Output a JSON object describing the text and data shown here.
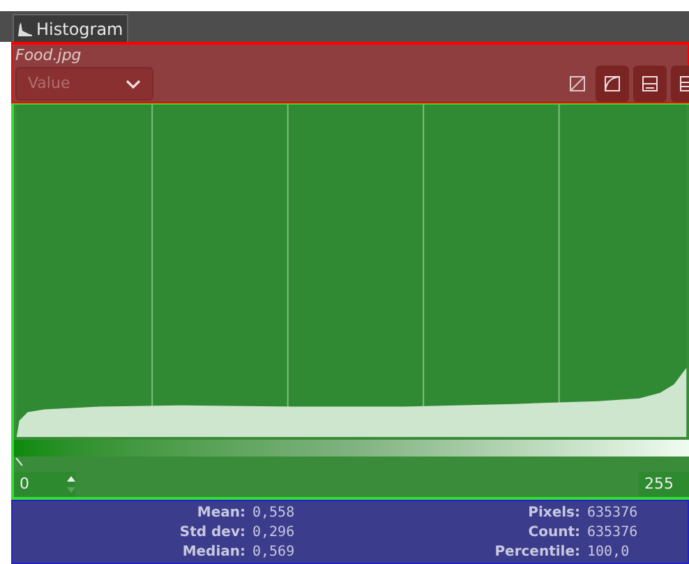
{
  "tab": {
    "label": "Histogram",
    "selected": true
  },
  "image_name": "Food.jpg",
  "channel_select": {
    "value": "Value",
    "disabled": true
  },
  "toolbar": [
    {
      "kind": "linear",
      "selected": false
    },
    {
      "kind": "log",
      "selected": true
    },
    {
      "kind": "display",
      "selected": true
    },
    {
      "kind": "display2",
      "selected": true
    }
  ],
  "range": {
    "low": "0",
    "high": "255"
  },
  "stats": [
    [
      {
        "label": "Mean:",
        "value": "0,558"
      },
      {
        "label": "Std dev:",
        "value": "0,296"
      },
      {
        "label": "Median:",
        "value": "0,569"
      }
    ],
    [
      {
        "label": "Pixels:",
        "value": "635376"
      },
      {
        "label": "Count:",
        "value": "635376"
      },
      {
        "label": "Percentile:",
        "value": "100,0"
      }
    ]
  ]
}
